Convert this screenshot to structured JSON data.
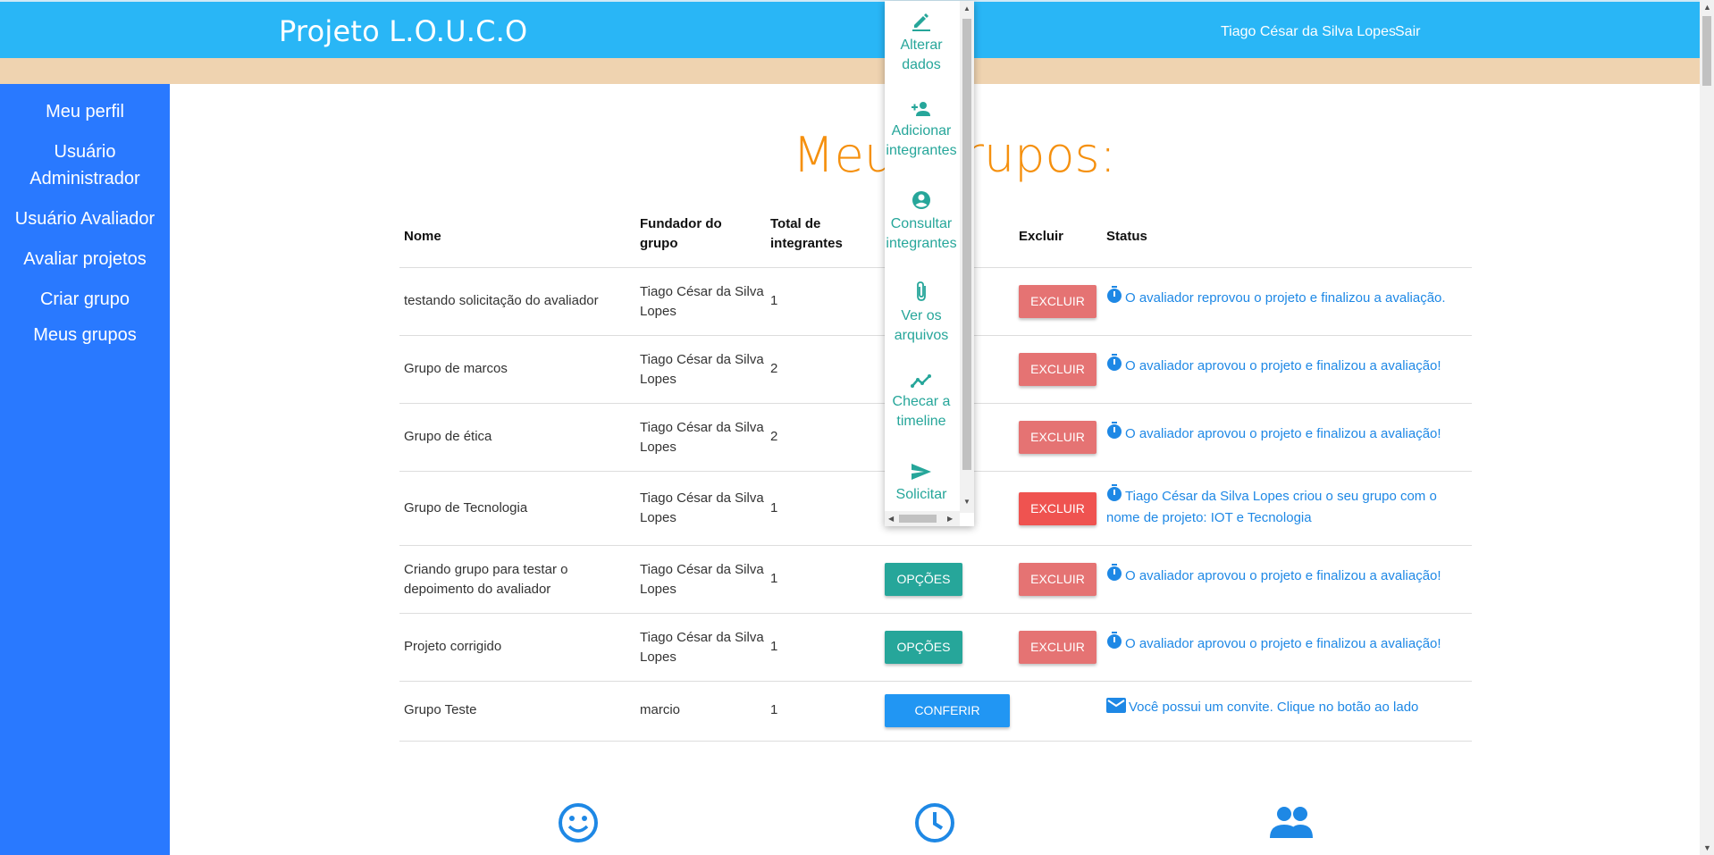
{
  "header": {
    "brand": "Projeto L.O.U.C.O",
    "user_name": "Tiago César da Silva Lopes",
    "logout": "Sair"
  },
  "sidebar": {
    "items": [
      {
        "label": "Meu perfil"
      },
      {
        "label": "Usuário Administrador"
      },
      {
        "label": "Usuário Avaliador"
      },
      {
        "label": "Avaliar projetos"
      },
      {
        "label": "Criar grupo"
      },
      {
        "label": "Meus grupos"
      }
    ]
  },
  "page_title": "Meus grupos:",
  "table": {
    "headers": {
      "nome": "Nome",
      "fundador": "Fundador do grupo",
      "total": "Total de integrantes",
      "excluir": "Excluir",
      "status": "Status"
    },
    "rows": [
      {
        "nome": "testando solicitação do avaliador",
        "fundador": "Tiago César da Silva Lopes",
        "total": "1",
        "excluir": "EXCLUIR",
        "status": "O avaliador reprovou o projeto e finalizou a avaliação."
      },
      {
        "nome": "Grupo de marcos",
        "fundador": "Tiago César da Silva Lopes",
        "total": "2",
        "excluir": "EXCLUIR",
        "status": "O avaliador aprovou o projeto e finalizou a avaliação!"
      },
      {
        "nome": "Grupo de ética",
        "fundador": "Tiago César da Silva Lopes",
        "total": "2",
        "excluir": "EXCLUIR",
        "status": "O avaliador aprovou o projeto e finalizou a avaliação!"
      },
      {
        "nome": "Grupo de Tecnologia",
        "fundador": "Tiago César da Silva Lopes",
        "total": "1",
        "excluir": "EXCLUIR",
        "status": "Tiago César da Silva Lopes criou o seu grupo com o nome de projeto: IOT e Tecnologia"
      },
      {
        "nome": "Criando grupo para testar o depoimento do avaliador",
        "fundador": "Tiago César da Silva Lopes",
        "total": "1",
        "opcoes": "OPÇÕES",
        "excluir": "EXCLUIR",
        "status": "O avaliador aprovou o projeto e finalizou a avaliação!"
      },
      {
        "nome": "Projeto corrigido",
        "fundador": "Tiago César da Silva Lopes",
        "total": "1",
        "opcoes": "OPÇÕES",
        "excluir": "EXCLUIR",
        "status": "O avaliador aprovou o projeto e finalizou a avaliação!"
      },
      {
        "nome": "Grupo Teste",
        "fundador": "marcio",
        "total": "1",
        "conferir": "CONFERIR",
        "status": "Você possui um convite. Clique no botão ao lado"
      }
    ]
  },
  "dropdown": {
    "items": [
      {
        "label": "Alterar dados",
        "icon": "edit-icon"
      },
      {
        "label": "Adicionar integrantes",
        "icon": "person-add-icon"
      },
      {
        "label": "Consultar integrantes",
        "icon": "account-circle-icon"
      },
      {
        "label": "Ver os arquivos",
        "icon": "attach-file-icon"
      },
      {
        "label": "Checar a timeline",
        "icon": "timeline-icon"
      },
      {
        "label": "Solicitar",
        "icon": "send-icon"
      }
    ]
  },
  "colors": {
    "header": "#29b6f6",
    "sidebar": "#2979ff",
    "title": "#f5900e",
    "excluir": "#e57373",
    "opcoes": "#26a69a",
    "conferir": "#2196f3",
    "status_text": "#1e88e5"
  },
  "bottom_icons": [
    "smiley-face-icon",
    "clock-icon",
    "people-icon"
  ]
}
